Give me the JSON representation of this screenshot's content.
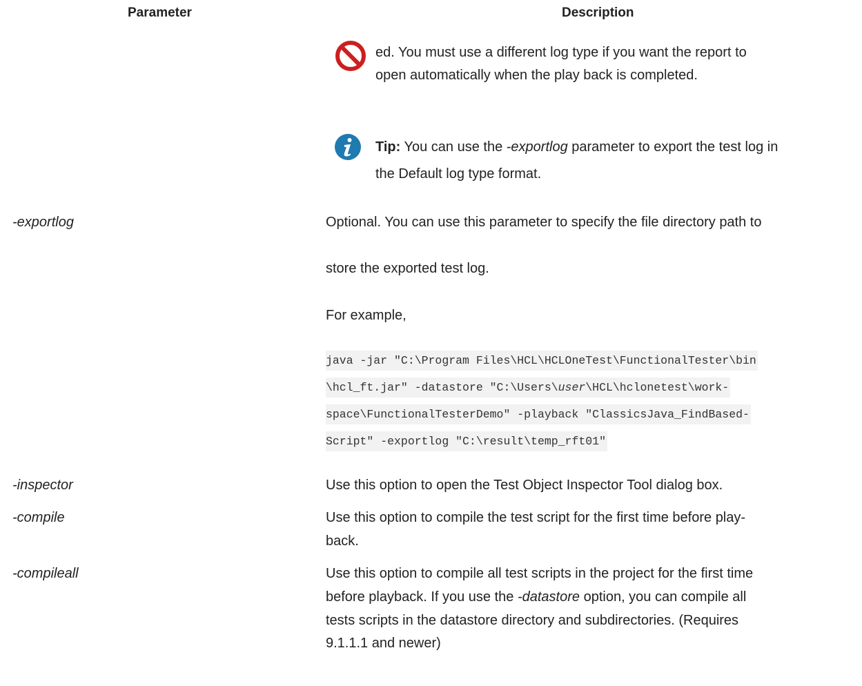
{
  "header": {
    "parameter": "Parameter",
    "description": "Description"
  },
  "caution_note": {
    "icon": "prohibited-icon",
    "color": "#cc1f1f",
    "line1": "ed. You must use a different log type if you want the report to",
    "line2": "open automatically when the play back is completed."
  },
  "tip_note": {
    "icon": "info-icon",
    "color": "#1f7ab0",
    "label": "Tip:",
    "text_before": " You can use the ",
    "param": "-exportlog",
    "text_after": " parameter to export the test log in",
    "line2": "the Default log type format."
  },
  "rows": {
    "exportlog": {
      "param": "-exportlog",
      "line1": "Optional. You can use this parameter to specify the file directory path to",
      "line2": "store the exported test log.",
      "example_label": "For example,",
      "code": {
        "l1": "java -jar \"C:\\Program Files\\HCL\\HCLOneTest\\FunctionalTester\\bin",
        "l2a": "\\hcl_ft.jar\" -datastore \"C:\\Users\\",
        "l2user": "user",
        "l2b": "\\HCL\\hclonetest\\work-",
        "l3": "space\\FunctionalTesterDemo\" -playback \"ClassicsJava_FindBased-",
        "l4": "Script\" -exportlog \"C:\\result\\temp_rft01\""
      }
    },
    "inspector": {
      "param": "-inspector",
      "line1": "Use this option to open the Test Object Inspector Tool dialog box."
    },
    "compile": {
      "param": "-compile",
      "line1": "Use this option to compile the test script for the first time before play-",
      "line2": "back."
    },
    "compileall": {
      "param": "-compileall",
      "line1": "Use this option to compile all test scripts in the project for the first time",
      "line2_before": "before playback. If you use the ",
      "line2_param": "-datastore",
      "line2_after": " option, you can compile all",
      "line3": "tests scripts in the datastore directory and subdirectories. (Requires",
      "line4": "9.1.1.1 and newer)"
    }
  }
}
